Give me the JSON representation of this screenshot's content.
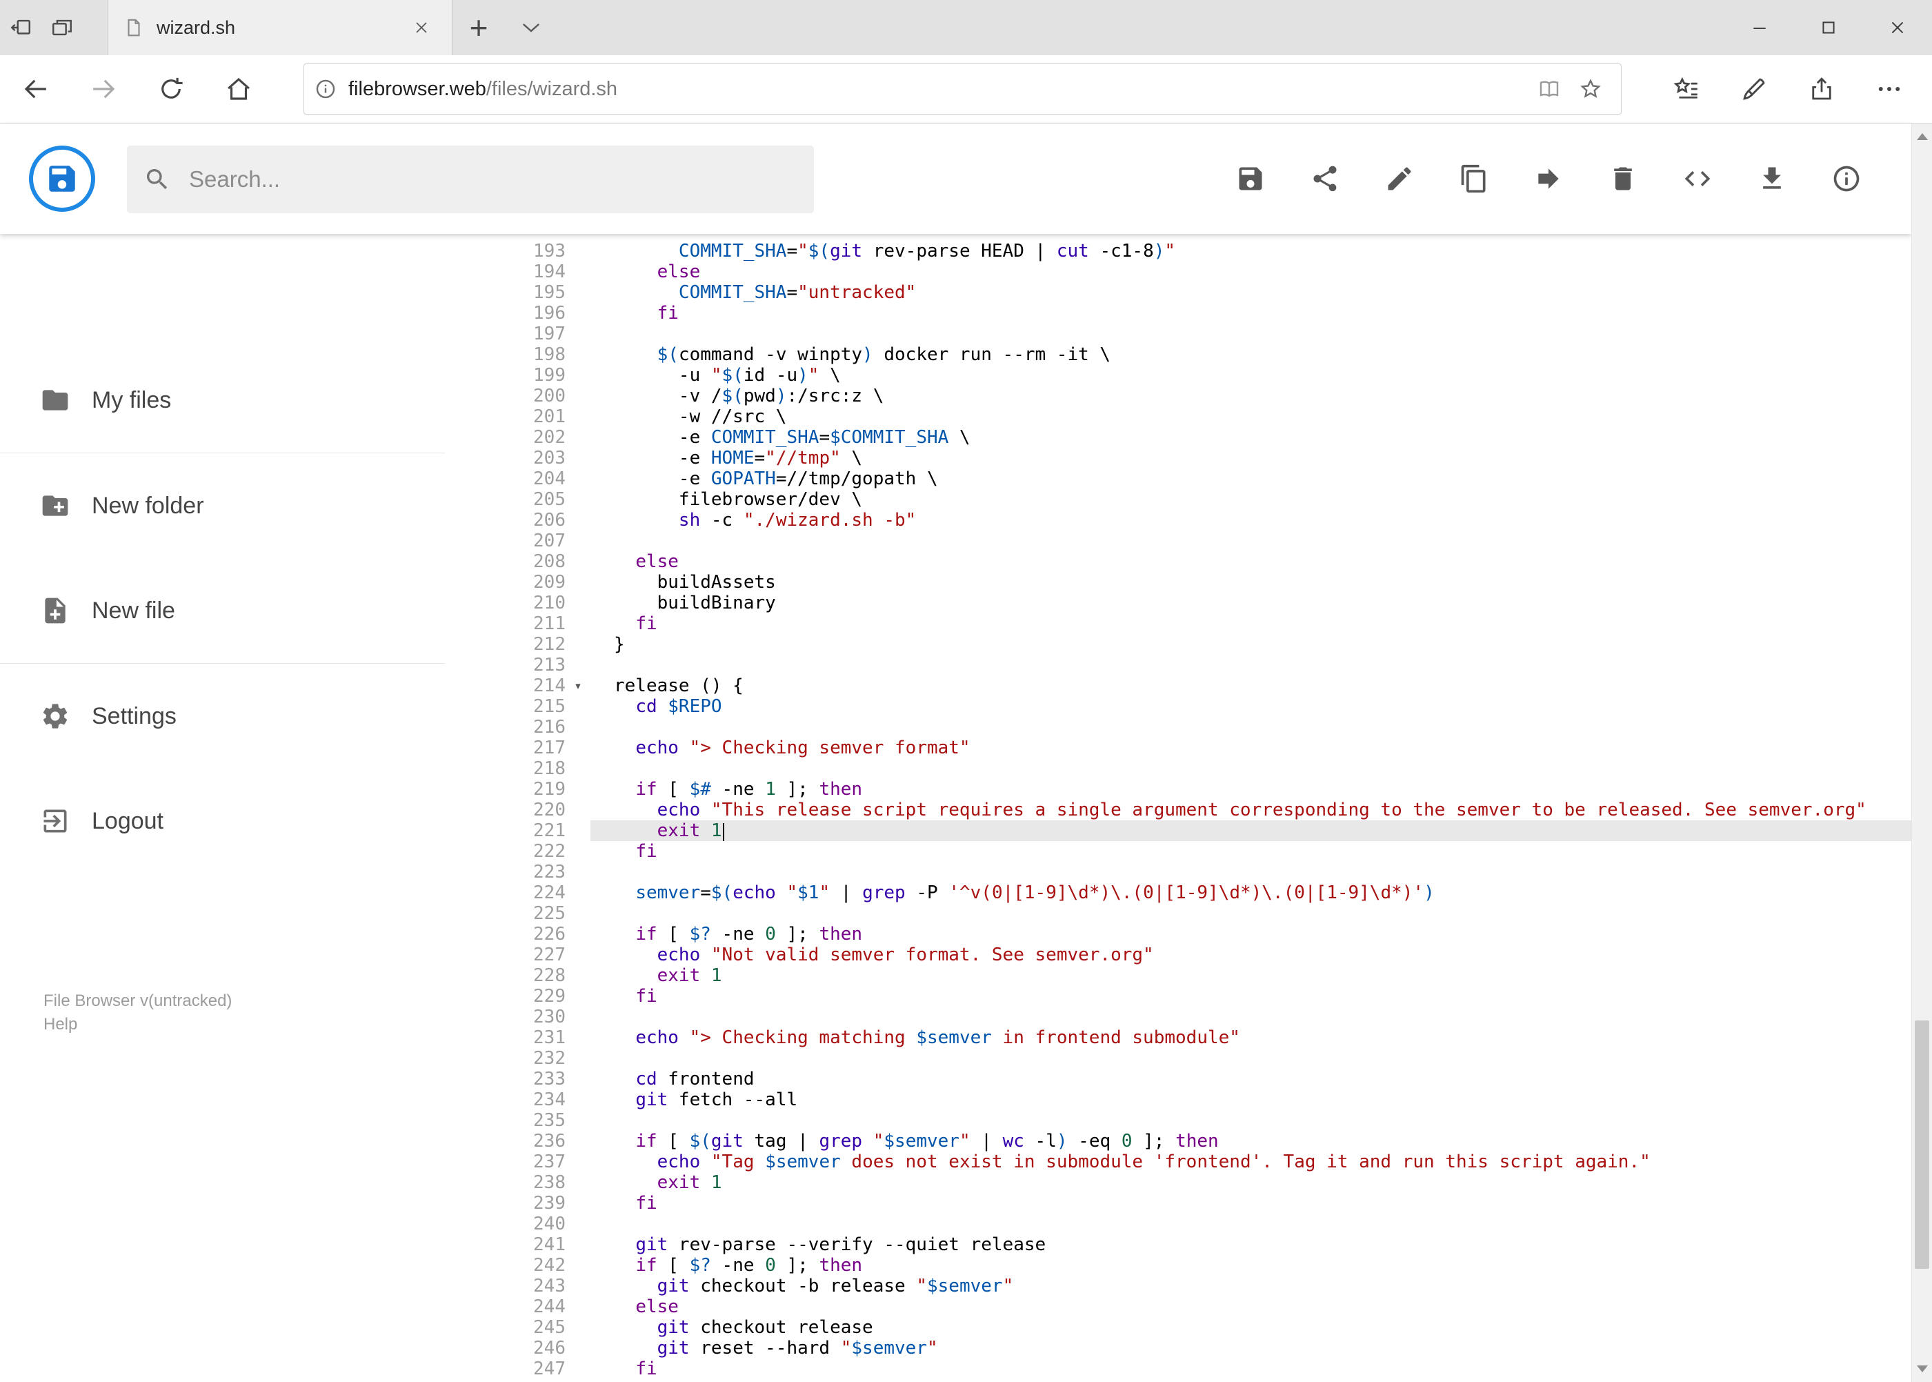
{
  "browser": {
    "tab_title": "wizard.sh",
    "url_domain": "filebrowser.web",
    "url_path": "/files/wizard.sh"
  },
  "header": {
    "search_placeholder": "Search...",
    "action_icons": [
      "save",
      "share",
      "rename",
      "copy",
      "move",
      "delete",
      "code",
      "download",
      "info"
    ],
    "accent_color": "#1e88e5"
  },
  "sidebar": {
    "items": [
      {
        "icon": "folder",
        "label": "My files"
      },
      {
        "icon": "folder-plus",
        "label": "New folder"
      },
      {
        "icon": "file-plus",
        "label": "New file"
      },
      {
        "icon": "gear",
        "label": "Settings"
      },
      {
        "icon": "logout",
        "label": "Logout"
      }
    ],
    "footer_version": "File Browser v(untracked)",
    "footer_help": "Help"
  },
  "editor": {
    "active_line": 221,
    "fold_marker_line": 214,
    "syntax_colors": {
      "keyword": "#770088",
      "builtin": "#3300aa",
      "variable": "#0055aa",
      "string": "#aa1111",
      "number": "#116644"
    },
    "lines": [
      {
        "n": 193,
        "t": [
          [
            "p",
            "      "
          ],
          [
            "d",
            "COMMIT_SHA"
          ],
          [
            "p",
            "="
          ],
          [
            "s",
            "\""
          ],
          [
            "d",
            "$("
          ],
          [
            "b",
            "git"
          ],
          [
            "p",
            " rev-parse HEAD | "
          ],
          [
            "b",
            "cut"
          ],
          [
            "p",
            " -c1-8"
          ],
          [
            "d",
            ")"
          ],
          [
            "s",
            "\""
          ]
        ]
      },
      {
        "n": 194,
        "t": [
          [
            "p",
            "    "
          ],
          [
            "k",
            "else"
          ]
        ]
      },
      {
        "n": 195,
        "t": [
          [
            "p",
            "      "
          ],
          [
            "d",
            "COMMIT_SHA"
          ],
          [
            "p",
            "="
          ],
          [
            "s",
            "\"untracked\""
          ]
        ]
      },
      {
        "n": 196,
        "t": [
          [
            "p",
            "    "
          ],
          [
            "k",
            "fi"
          ]
        ]
      },
      {
        "n": 197,
        "t": []
      },
      {
        "n": 198,
        "t": [
          [
            "p",
            "    "
          ],
          [
            "d",
            "$("
          ],
          [
            "p",
            "command -v winpty"
          ],
          [
            "d",
            ")"
          ],
          [
            "p",
            " docker run --rm -it \\"
          ]
        ]
      },
      {
        "n": 199,
        "t": [
          [
            "p",
            "      -u "
          ],
          [
            "s",
            "\""
          ],
          [
            "d",
            "$("
          ],
          [
            "p",
            "id -u"
          ],
          [
            "d",
            ")"
          ],
          [
            "s",
            "\""
          ],
          [
            "p",
            " \\"
          ]
        ]
      },
      {
        "n": 200,
        "t": [
          [
            "p",
            "      -v /"
          ],
          [
            "d",
            "$("
          ],
          [
            "p",
            "pwd"
          ],
          [
            "d",
            ")"
          ],
          [
            "p",
            ":/src:z \\"
          ]
        ]
      },
      {
        "n": 201,
        "t": [
          [
            "p",
            "      -w //src \\"
          ]
        ]
      },
      {
        "n": 202,
        "t": [
          [
            "p",
            "      -e "
          ],
          [
            "d",
            "COMMIT_SHA"
          ],
          [
            "p",
            "="
          ],
          [
            "d",
            "$COMMIT_SHA"
          ],
          [
            "p",
            " \\"
          ]
        ]
      },
      {
        "n": 203,
        "t": [
          [
            "p",
            "      -e "
          ],
          [
            "d",
            "HOME"
          ],
          [
            "p",
            "="
          ],
          [
            "s",
            "\"//tmp\""
          ],
          [
            "p",
            " \\"
          ]
        ]
      },
      {
        "n": 204,
        "t": [
          [
            "p",
            "      -e "
          ],
          [
            "d",
            "GOPATH"
          ],
          [
            "p",
            "=//tmp/gopath \\"
          ]
        ]
      },
      {
        "n": 205,
        "t": [
          [
            "p",
            "      filebrowser/dev \\"
          ]
        ]
      },
      {
        "n": 206,
        "t": [
          [
            "p",
            "      "
          ],
          [
            "b",
            "sh"
          ],
          [
            "p",
            " -c "
          ],
          [
            "s",
            "\"./wizard.sh -b\""
          ]
        ]
      },
      {
        "n": 207,
        "t": []
      },
      {
        "n": 208,
        "t": [
          [
            "p",
            "  "
          ],
          [
            "k",
            "else"
          ]
        ]
      },
      {
        "n": 209,
        "t": [
          [
            "p",
            "    buildAssets"
          ]
        ]
      },
      {
        "n": 210,
        "t": [
          [
            "p",
            "    buildBinary"
          ]
        ]
      },
      {
        "n": 211,
        "t": [
          [
            "p",
            "  "
          ],
          [
            "k",
            "fi"
          ]
        ]
      },
      {
        "n": 212,
        "t": [
          [
            "p",
            "}"
          ]
        ]
      },
      {
        "n": 213,
        "t": []
      },
      {
        "n": 214,
        "t": [
          [
            "p",
            "release () {"
          ]
        ]
      },
      {
        "n": 215,
        "t": [
          [
            "p",
            "  "
          ],
          [
            "b",
            "cd"
          ],
          [
            "p",
            " "
          ],
          [
            "d",
            "$REPO"
          ]
        ]
      },
      {
        "n": 216,
        "t": []
      },
      {
        "n": 217,
        "t": [
          [
            "p",
            "  "
          ],
          [
            "b",
            "echo"
          ],
          [
            "p",
            " "
          ],
          [
            "s",
            "\"> Checking semver format\""
          ]
        ]
      },
      {
        "n": 218,
        "t": []
      },
      {
        "n": 219,
        "t": [
          [
            "p",
            "  "
          ],
          [
            "k",
            "if"
          ],
          [
            "p",
            " [ "
          ],
          [
            "d",
            "$#"
          ],
          [
            "p",
            " -ne "
          ],
          [
            "n",
            "1"
          ],
          [
            "p",
            " ]; "
          ],
          [
            "k",
            "then"
          ]
        ]
      },
      {
        "n": 220,
        "t": [
          [
            "p",
            "    "
          ],
          [
            "b",
            "echo"
          ],
          [
            "p",
            " "
          ],
          [
            "s",
            "\"This release script requires a single argument corresponding to the semver to be released. See semver.org\""
          ]
        ]
      },
      {
        "n": 221,
        "t": [
          [
            "p",
            "    "
          ],
          [
            "k",
            "exit"
          ],
          [
            "p",
            " "
          ],
          [
            "n",
            "1"
          ]
        ]
      },
      {
        "n": 222,
        "t": [
          [
            "p",
            "  "
          ],
          [
            "k",
            "fi"
          ]
        ]
      },
      {
        "n": 223,
        "t": []
      },
      {
        "n": 224,
        "t": [
          [
            "p",
            "  "
          ],
          [
            "d",
            "semver"
          ],
          [
            "p",
            "="
          ],
          [
            "d",
            "$("
          ],
          [
            "b",
            "echo"
          ],
          [
            "p",
            " "
          ],
          [
            "s",
            "\""
          ],
          [
            "d",
            "$1"
          ],
          [
            "s",
            "\""
          ],
          [
            "p",
            " | "
          ],
          [
            "b",
            "grep"
          ],
          [
            "p",
            " -P "
          ],
          [
            "s",
            "'^v(0|[1-9]\\d*)\\.(0|[1-9]\\d*)\\.(0|[1-9]\\d*)'"
          ],
          [
            "d",
            ")"
          ]
        ]
      },
      {
        "n": 225,
        "t": []
      },
      {
        "n": 226,
        "t": [
          [
            "p",
            "  "
          ],
          [
            "k",
            "if"
          ],
          [
            "p",
            " [ "
          ],
          [
            "d",
            "$?"
          ],
          [
            "p",
            " -ne "
          ],
          [
            "n",
            "0"
          ],
          [
            "p",
            " ]; "
          ],
          [
            "k",
            "then"
          ]
        ]
      },
      {
        "n": 227,
        "t": [
          [
            "p",
            "    "
          ],
          [
            "b",
            "echo"
          ],
          [
            "p",
            " "
          ],
          [
            "s",
            "\"Not valid semver format. See semver.org\""
          ]
        ]
      },
      {
        "n": 228,
        "t": [
          [
            "p",
            "    "
          ],
          [
            "k",
            "exit"
          ],
          [
            "p",
            " "
          ],
          [
            "n",
            "1"
          ]
        ]
      },
      {
        "n": 229,
        "t": [
          [
            "p",
            "  "
          ],
          [
            "k",
            "fi"
          ]
        ]
      },
      {
        "n": 230,
        "t": []
      },
      {
        "n": 231,
        "t": [
          [
            "p",
            "  "
          ],
          [
            "b",
            "echo"
          ],
          [
            "p",
            " "
          ],
          [
            "s",
            "\"> Checking matching "
          ],
          [
            "d",
            "$semver"
          ],
          [
            "s",
            " in frontend submodule\""
          ]
        ]
      },
      {
        "n": 232,
        "t": []
      },
      {
        "n": 233,
        "t": [
          [
            "p",
            "  "
          ],
          [
            "b",
            "cd"
          ],
          [
            "p",
            " frontend"
          ]
        ]
      },
      {
        "n": 234,
        "t": [
          [
            "p",
            "  "
          ],
          [
            "b",
            "git"
          ],
          [
            "p",
            " fetch --all"
          ]
        ]
      },
      {
        "n": 235,
        "t": []
      },
      {
        "n": 236,
        "t": [
          [
            "p",
            "  "
          ],
          [
            "k",
            "if"
          ],
          [
            "p",
            " [ "
          ],
          [
            "d",
            "$("
          ],
          [
            "b",
            "git"
          ],
          [
            "p",
            " tag | "
          ],
          [
            "b",
            "grep"
          ],
          [
            "p",
            " "
          ],
          [
            "s",
            "\""
          ],
          [
            "d",
            "$semver"
          ],
          [
            "s",
            "\""
          ],
          [
            "p",
            " | "
          ],
          [
            "b",
            "wc"
          ],
          [
            "p",
            " -l"
          ],
          [
            "d",
            ")"
          ],
          [
            "p",
            " -eq "
          ],
          [
            "n",
            "0"
          ],
          [
            "p",
            " ]; "
          ],
          [
            "k",
            "then"
          ]
        ]
      },
      {
        "n": 237,
        "t": [
          [
            "p",
            "    "
          ],
          [
            "b",
            "echo"
          ],
          [
            "p",
            " "
          ],
          [
            "s",
            "\"Tag "
          ],
          [
            "d",
            "$semver"
          ],
          [
            "s",
            " does not exist in submodule 'frontend'. Tag it and run this script again.\""
          ]
        ]
      },
      {
        "n": 238,
        "t": [
          [
            "p",
            "    "
          ],
          [
            "k",
            "exit"
          ],
          [
            "p",
            " "
          ],
          [
            "n",
            "1"
          ]
        ]
      },
      {
        "n": 239,
        "t": [
          [
            "p",
            "  "
          ],
          [
            "k",
            "fi"
          ]
        ]
      },
      {
        "n": 240,
        "t": []
      },
      {
        "n": 241,
        "t": [
          [
            "p",
            "  "
          ],
          [
            "b",
            "git"
          ],
          [
            "p",
            " rev-parse --verify --quiet release"
          ]
        ]
      },
      {
        "n": 242,
        "t": [
          [
            "p",
            "  "
          ],
          [
            "k",
            "if"
          ],
          [
            "p",
            " [ "
          ],
          [
            "d",
            "$?"
          ],
          [
            "p",
            " -ne "
          ],
          [
            "n",
            "0"
          ],
          [
            "p",
            " ]; "
          ],
          [
            "k",
            "then"
          ]
        ]
      },
      {
        "n": 243,
        "t": [
          [
            "p",
            "    "
          ],
          [
            "b",
            "git"
          ],
          [
            "p",
            " checkout -b release "
          ],
          [
            "s",
            "\""
          ],
          [
            "d",
            "$semver"
          ],
          [
            "s",
            "\""
          ]
        ]
      },
      {
        "n": 244,
        "t": [
          [
            "p",
            "  "
          ],
          [
            "k",
            "else"
          ]
        ]
      },
      {
        "n": 245,
        "t": [
          [
            "p",
            "    "
          ],
          [
            "b",
            "git"
          ],
          [
            "p",
            " checkout release"
          ]
        ]
      },
      {
        "n": 246,
        "t": [
          [
            "p",
            "    "
          ],
          [
            "b",
            "git"
          ],
          [
            "p",
            " reset --hard "
          ],
          [
            "s",
            "\""
          ],
          [
            "d",
            "$semver"
          ],
          [
            "s",
            "\""
          ]
        ]
      },
      {
        "n": 247,
        "t": [
          [
            "p",
            "  "
          ],
          [
            "k",
            "fi"
          ]
        ]
      }
    ]
  }
}
